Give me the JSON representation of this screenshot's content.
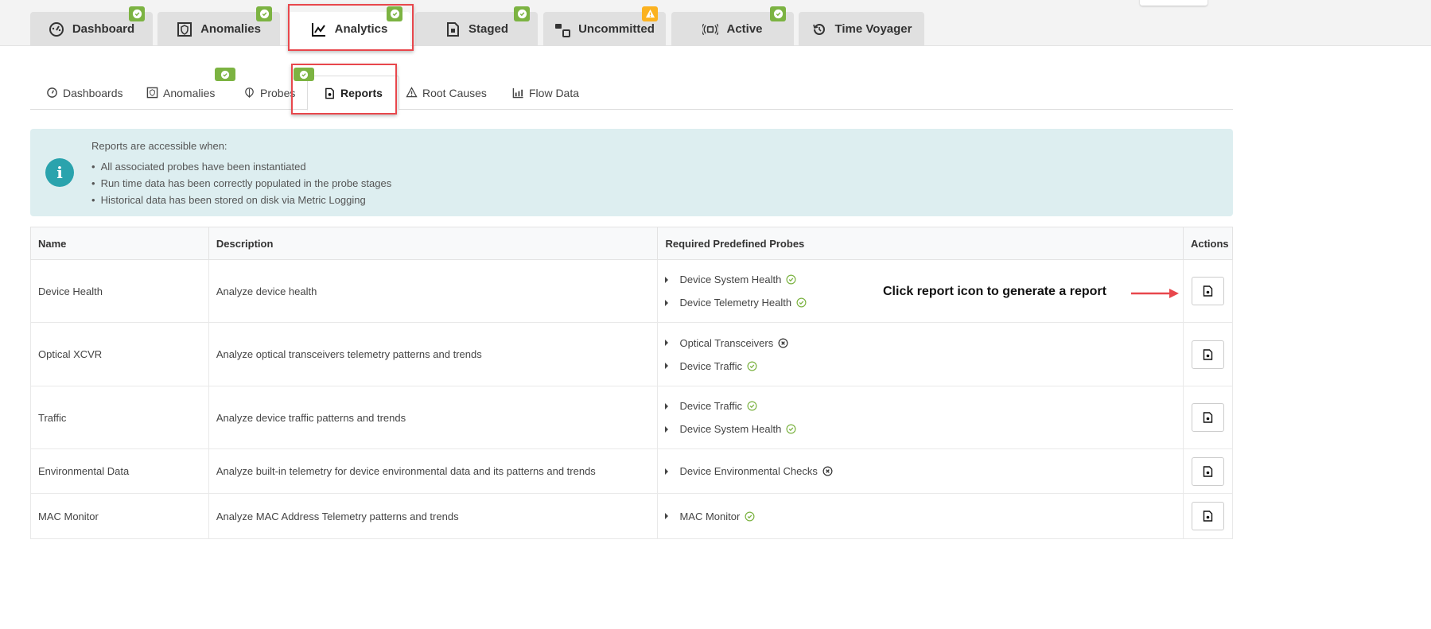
{
  "top_tabs": [
    {
      "label": "Dashboard",
      "icon": "dashboard-gauge-icon",
      "badge": "ok"
    },
    {
      "label": "Anomalies",
      "icon": "anomalies-shield-icon",
      "badge": "ok"
    },
    {
      "label": "Analytics",
      "icon": "analytics-chart-icon",
      "badge": "ok",
      "active": true
    },
    {
      "label": "Staged",
      "icon": "staged-file-icon",
      "badge": "ok"
    },
    {
      "label": "Uncommitted",
      "icon": "uncommitted-boxes-icon",
      "badge": "warning"
    },
    {
      "label": "Active",
      "icon": "active-signal-icon",
      "badge": "ok"
    },
    {
      "label": "Time Voyager",
      "icon": "history-icon"
    }
  ],
  "sub_tabs": [
    {
      "label": "Dashboards"
    },
    {
      "label": "Anomalies",
      "badge": "ok"
    },
    {
      "label": "Probes"
    },
    {
      "label": "Reports",
      "badge": "ok",
      "active": true
    },
    {
      "label": "Root Causes"
    },
    {
      "label": "Flow Data"
    }
  ],
  "info": {
    "title": "Reports are accessible when:",
    "items": [
      "All associated probes have been instantiated",
      "Run time data has been correctly populated in the probe stages",
      "Historical data has been stored on disk via Metric Logging"
    ]
  },
  "table": {
    "headers": [
      "Name",
      "Description",
      "Required Predefined Probes",
      "Actions"
    ],
    "rows": [
      {
        "name": "Device Health",
        "description": "Analyze device health",
        "probes": [
          {
            "name": "Device System Health",
            "status": "ok"
          },
          {
            "name": "Device Telemetry Health",
            "status": "ok"
          }
        ]
      },
      {
        "name": "Optical XCVR",
        "description": "Analyze optical transceivers telemetry patterns and trends",
        "probes": [
          {
            "name": "Optical Transceivers",
            "status": "missing"
          },
          {
            "name": "Device Traffic",
            "status": "ok"
          }
        ]
      },
      {
        "name": "Traffic",
        "description": "Analyze device traffic patterns and trends",
        "probes": [
          {
            "name": "Device Traffic",
            "status": "ok"
          },
          {
            "name": "Device System Health",
            "status": "ok"
          }
        ]
      },
      {
        "name": "Environmental Data",
        "description": "Analyze built-in telemetry for device environmental data and its patterns and trends",
        "probes": [
          {
            "name": "Device Environmental Checks",
            "status": "missing"
          }
        ]
      },
      {
        "name": "MAC Monitor",
        "description": "Analyze MAC Address Telemetry patterns and trends",
        "probes": [
          {
            "name": "MAC Monitor",
            "status": "ok"
          }
        ]
      }
    ]
  },
  "annotation": "Click report icon to generate a report",
  "colors": {
    "ok": "#7cb342",
    "warning": "#fbb220",
    "highlight": "#e8474c",
    "info_bg": "#ddeef0"
  }
}
